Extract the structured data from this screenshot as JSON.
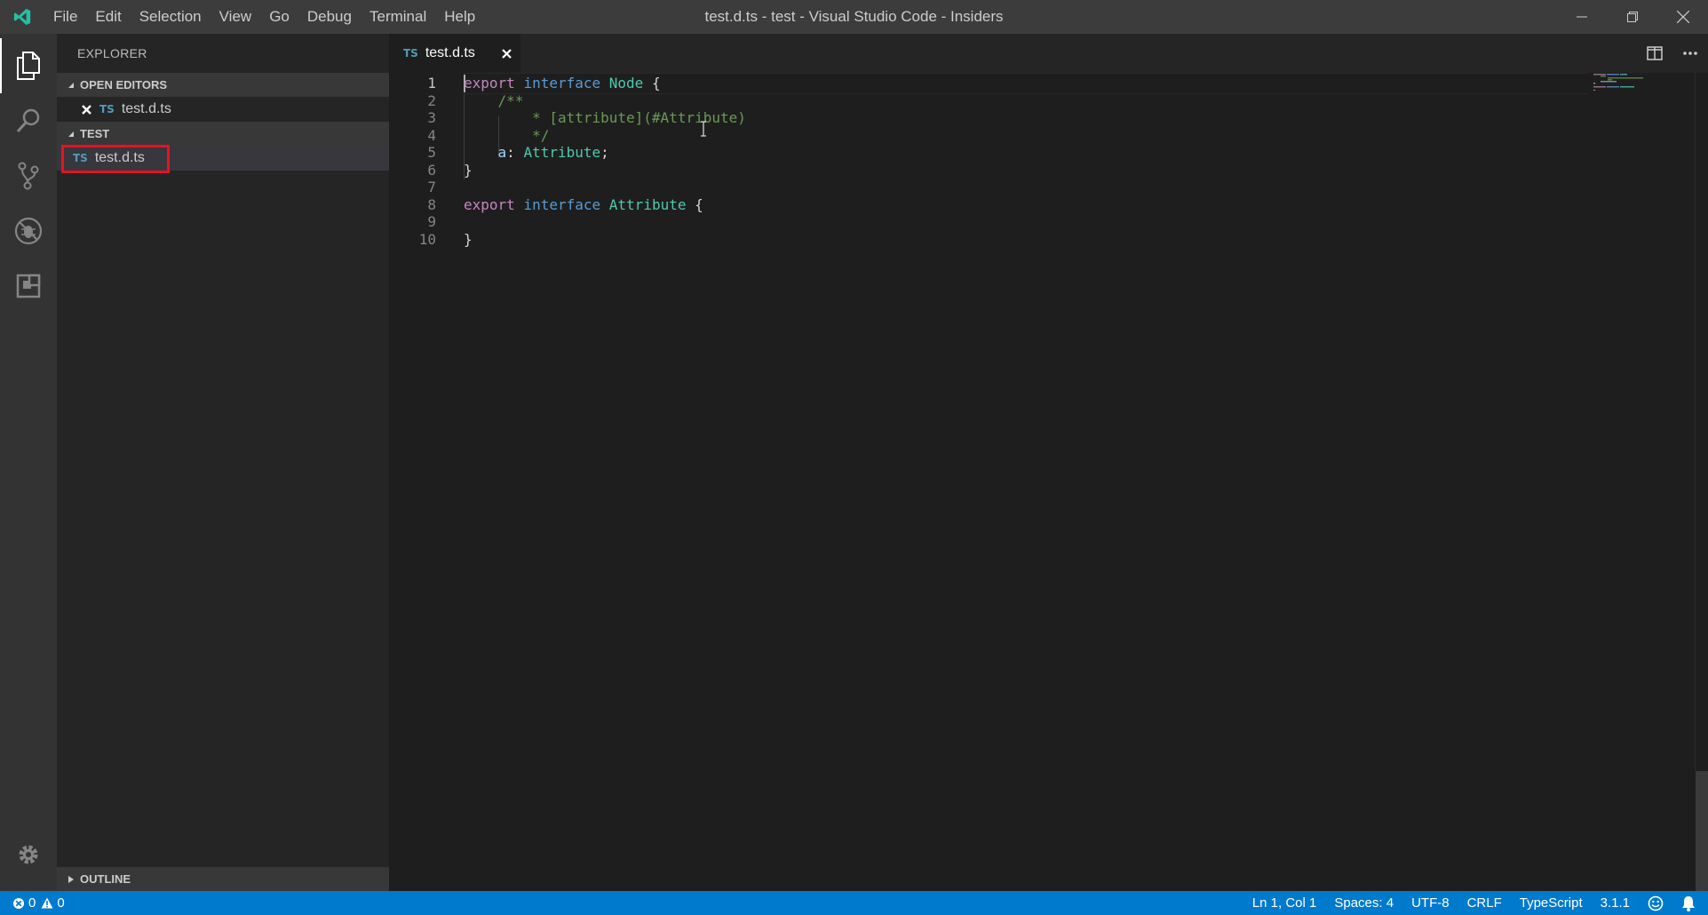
{
  "window": {
    "title": "test.d.ts - test - Visual Studio Code - Insiders",
    "menu": [
      "File",
      "Edit",
      "Selection",
      "View",
      "Go",
      "Debug",
      "Terminal",
      "Help"
    ]
  },
  "activity_bar": {
    "items": [
      {
        "icon": "files-icon",
        "active": true
      },
      {
        "icon": "search-icon",
        "active": false
      },
      {
        "icon": "source-control-icon",
        "active": false
      },
      {
        "icon": "debug-icon",
        "active": false
      },
      {
        "icon": "extensions-icon",
        "active": false
      }
    ],
    "bottom_icon": "gear-icon"
  },
  "sidebar": {
    "title": "EXPLORER",
    "open_editors": {
      "header": "OPEN EDITORS",
      "files": [
        {
          "badge": "TS",
          "name": "test.d.ts"
        }
      ]
    },
    "folder": {
      "header": "TEST",
      "files": [
        {
          "badge": "TS",
          "name": "test.d.ts"
        }
      ]
    },
    "outline": {
      "header": "OUTLINE"
    }
  },
  "editor": {
    "tab": {
      "badge": "TS",
      "name": "test.d.ts"
    },
    "line_numbers": [
      "1",
      "2",
      "3",
      "4",
      "5",
      "6",
      "7",
      "8",
      "9",
      "10"
    ],
    "lines": [
      [
        {
          "t": "export",
          "c": "kw"
        },
        {
          "t": " ",
          "c": "punc"
        },
        {
          "t": "interface",
          "c": "kw2"
        },
        {
          "t": " ",
          "c": "punc"
        },
        {
          "t": "Node",
          "c": "type"
        },
        {
          "t": " {",
          "c": "punc"
        }
      ],
      [
        {
          "t": "    ",
          "c": "punc"
        },
        {
          "t": "/**",
          "c": "comment"
        }
      ],
      [
        {
          "t": "        * [attribute](#Attribute)",
          "c": "comment"
        }
      ],
      [
        {
          "t": "        */",
          "c": "comment"
        }
      ],
      [
        {
          "t": "    ",
          "c": "punc"
        },
        {
          "t": "a",
          "c": "prop"
        },
        {
          "t": ": ",
          "c": "punc"
        },
        {
          "t": "Attribute",
          "c": "type"
        },
        {
          "t": ";",
          "c": "punc"
        }
      ],
      [
        {
          "t": "}",
          "c": "punc"
        }
      ],
      [],
      [
        {
          "t": "export",
          "c": "kw"
        },
        {
          "t": " ",
          "c": "punc"
        },
        {
          "t": "interface",
          "c": "kw2"
        },
        {
          "t": " ",
          "c": "punc"
        },
        {
          "t": "Attribute",
          "c": "type"
        },
        {
          "t": " {",
          "c": "punc"
        }
      ],
      [],
      [
        {
          "t": "}",
          "c": "punc"
        }
      ]
    ]
  },
  "status_bar": {
    "errors": "0",
    "warnings": "0",
    "position": "Ln 1, Col 1",
    "spaces": "Spaces: 4",
    "encoding": "UTF-8",
    "eol": "CRLF",
    "language": "TypeScript",
    "version": "3.1.1"
  },
  "colors": {
    "accent": "#007acc",
    "highlight_box": "#e81123",
    "vscode_insiders_logo": "#24bfa5"
  }
}
